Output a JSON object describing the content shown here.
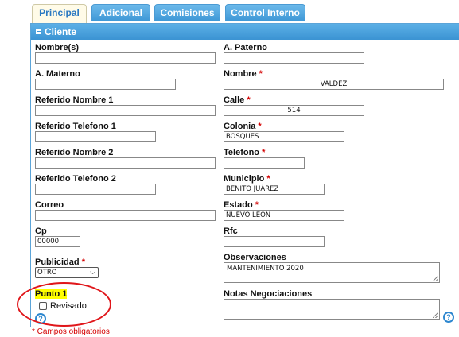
{
  "tabs": [
    "Principal",
    "Adicional",
    "Comisiones",
    "Control Interno"
  ],
  "section_title": "Cliente",
  "fields": {
    "nombres": {
      "label": "Nombre(s)",
      "value": ""
    },
    "a_paterno": {
      "label": "A. Paterno",
      "value": ""
    },
    "a_materno": {
      "label": "A. Materno",
      "value": ""
    },
    "nombre": {
      "label": "Nombre",
      "value": "VALDEZ"
    },
    "ref_nombre1": {
      "label": "Referido Nombre 1",
      "value": ""
    },
    "calle": {
      "label": "Calle",
      "value": "514"
    },
    "ref_tel1": {
      "label": "Referido Telefono 1",
      "value": ""
    },
    "colonia": {
      "label": "Colonia",
      "value": "BOSQUES"
    },
    "ref_nombre2": {
      "label": "Referido Nombre 2",
      "value": ""
    },
    "telefono": {
      "label": "Telefono",
      "value": ""
    },
    "ref_tel2": {
      "label": "Referido Telefono 2",
      "value": ""
    },
    "municipio": {
      "label": "Municipio",
      "value": "BENITO JUÁREZ"
    },
    "correo": {
      "label": "Correo",
      "value": ""
    },
    "estado": {
      "label": "Estado",
      "value": "NUEVO LEÓN"
    },
    "cp": {
      "label": "Cp",
      "value": "00000"
    },
    "rfc": {
      "label": "Rfc",
      "value": ""
    },
    "publicidad": {
      "label": "Publicidad",
      "value": "OTRO"
    },
    "observaciones": {
      "label": "Observaciones",
      "value": "MANTENIMIENTO 2020"
    },
    "punto1": {
      "label": "Punto 1",
      "checkbox_label": "Revisado"
    },
    "notas": {
      "label": "Notas Negociaciones",
      "value": ""
    }
  },
  "required_mark": "*",
  "footer_note": "* Campos obligatorios",
  "help_glyph": "?",
  "icons": {
    "collapse": "minus-square-icon",
    "help": "help-circle-icon",
    "dropdown": "chevron-down-icon"
  },
  "colors": {
    "tab_blue": "#3d97d6",
    "required_red": "#d40000",
    "highlight": "#ffff00",
    "annotation_red": "#e0161a"
  }
}
